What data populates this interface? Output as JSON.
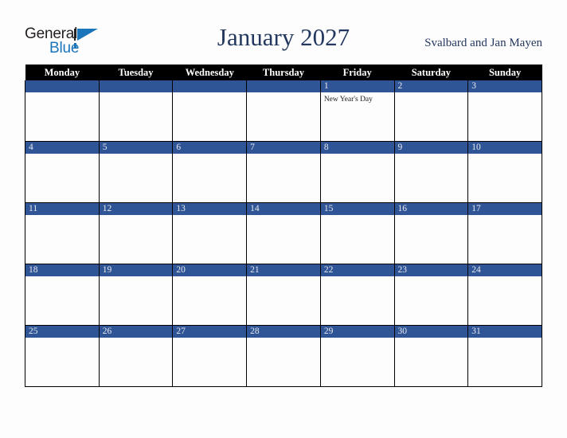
{
  "brand": {
    "name_part1": "General",
    "name_part2": "Blue",
    "triangle_icon": "triangle-icon",
    "color_black": "#231f20",
    "color_blue": "#1b75bb"
  },
  "header": {
    "title": "January 2027",
    "region": "Svalbard and Jan Mayen",
    "title_color": "#24385f"
  },
  "calendar": {
    "month": "January",
    "year": "2027",
    "header_bg": "#000000",
    "daybar_bg": "#2f5596",
    "weekday_headers": [
      "Monday",
      "Tuesday",
      "Wednesday",
      "Thursday",
      "Friday",
      "Saturday",
      "Sunday"
    ],
    "weeks": [
      [
        {
          "day": "",
          "holiday": ""
        },
        {
          "day": "",
          "holiday": ""
        },
        {
          "day": "",
          "holiday": ""
        },
        {
          "day": "",
          "holiday": ""
        },
        {
          "day": "1",
          "holiday": "New Year's Day"
        },
        {
          "day": "2",
          "holiday": ""
        },
        {
          "day": "3",
          "holiday": ""
        }
      ],
      [
        {
          "day": "4",
          "holiday": ""
        },
        {
          "day": "5",
          "holiday": ""
        },
        {
          "day": "6",
          "holiday": ""
        },
        {
          "day": "7",
          "holiday": ""
        },
        {
          "day": "8",
          "holiday": ""
        },
        {
          "day": "9",
          "holiday": ""
        },
        {
          "day": "10",
          "holiday": ""
        }
      ],
      [
        {
          "day": "11",
          "holiday": ""
        },
        {
          "day": "12",
          "holiday": ""
        },
        {
          "day": "13",
          "holiday": ""
        },
        {
          "day": "14",
          "holiday": ""
        },
        {
          "day": "15",
          "holiday": ""
        },
        {
          "day": "16",
          "holiday": ""
        },
        {
          "day": "17",
          "holiday": ""
        }
      ],
      [
        {
          "day": "18",
          "holiday": ""
        },
        {
          "day": "19",
          "holiday": ""
        },
        {
          "day": "20",
          "holiday": ""
        },
        {
          "day": "21",
          "holiday": ""
        },
        {
          "day": "22",
          "holiday": ""
        },
        {
          "day": "23",
          "holiday": ""
        },
        {
          "day": "24",
          "holiday": ""
        }
      ],
      [
        {
          "day": "25",
          "holiday": ""
        },
        {
          "day": "26",
          "holiday": ""
        },
        {
          "day": "27",
          "holiday": ""
        },
        {
          "day": "28",
          "holiday": ""
        },
        {
          "day": "29",
          "holiday": ""
        },
        {
          "day": "30",
          "holiday": ""
        },
        {
          "day": "31",
          "holiday": ""
        }
      ]
    ]
  }
}
